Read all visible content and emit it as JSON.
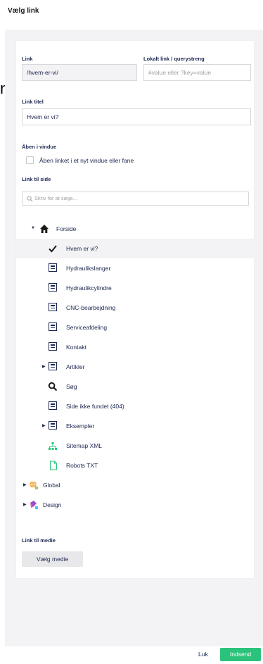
{
  "dialog": {
    "title": "Vælg link"
  },
  "form": {
    "link_label": "Link",
    "link_value": "/hvem-er-vi/",
    "anchor_label": "Lokalt link / querystreng",
    "anchor_placeholder": "#value eller ?key=value",
    "title_label": "Link titel",
    "title_value": "Hvem er vi?",
    "target_label": "Åben i vindue",
    "target_checkbox_label": "Åben linket i et nyt vindue eller fane",
    "page_label": "Link til side",
    "search_placeholder": "Skriv for at søge...",
    "media_label": "Link til medie",
    "media_button": "Vælg medie"
  },
  "tree": [
    {
      "label": "Forside",
      "icon": "home-icon",
      "level": 0,
      "expanded": true
    },
    {
      "label": "Hvem er vi?",
      "icon": "checkmark-icon",
      "level": 1,
      "selected": true
    },
    {
      "label": "Hydraulikslanger",
      "icon": "page-icon",
      "level": 1
    },
    {
      "label": "Hydraulikcylindre",
      "icon": "page-icon",
      "level": 1
    },
    {
      "label": "CNC-bearbejdning",
      "icon": "page-icon",
      "level": 1
    },
    {
      "label": "Serviceafdeling",
      "icon": "page-icon",
      "level": 1
    },
    {
      "label": "Kontakt",
      "icon": "page-icon",
      "level": 1
    },
    {
      "label": "Artikler",
      "icon": "list-page-icon",
      "level": 1,
      "collapsed": true
    },
    {
      "label": "Søg",
      "icon": "search-icon",
      "level": 1
    },
    {
      "label": "Side ikke fundet (404)",
      "icon": "page-icon",
      "level": 1
    },
    {
      "label": "Eksempler",
      "icon": "page-icon",
      "level": 1,
      "collapsed": true
    },
    {
      "label": "Sitemap XML",
      "icon": "sitemap-icon",
      "level": 1
    },
    {
      "label": "Robots TXT",
      "icon": "document-icon",
      "level": 1
    },
    {
      "label": "Global",
      "icon": "global-icon",
      "level": 0,
      "collapsed": true
    },
    {
      "label": "Design",
      "icon": "design-icon",
      "level": 0,
      "collapsed": true
    }
  ],
  "footer": {
    "close_label": "Luk",
    "submit_label": "Indsend"
  },
  "colors": {
    "accent_green": "#2bc37c",
    "text_navy": "#1b264f",
    "panel_gray": "#f3f3f5",
    "sitemap_green": "#2bc37c"
  }
}
